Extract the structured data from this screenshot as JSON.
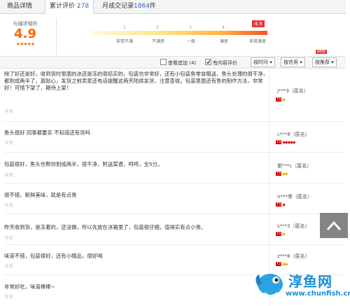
{
  "tabs": [
    {
      "label": "商品详情",
      "count": ""
    },
    {
      "label": "累计评价",
      "count": "278"
    },
    {
      "label": "月成交记录",
      "count": "1864",
      "suffix": "件"
    }
  ],
  "rating": {
    "label": "与描述相符",
    "score": "4.9",
    "stars": "★★★★★",
    "flag": "4.9",
    "ticks": [
      "1",
      "2",
      "3",
      "4",
      "5"
    ],
    "tick_labels": [
      "非常不满",
      "不满意",
      "一般",
      "满意",
      "非常满意"
    ]
  },
  "filters": {
    "follow_up": "查看追加 (4)",
    "has_content": "有内容评价",
    "sort_time": "按时间 ▾",
    "sort_credit": "按信用 ▾",
    "sort_recommend": "按推荐 ▾",
    "new_badge": "NEW"
  },
  "reviews": [
    {
      "text": "除了好还是好，收到货时里面的冰还是冻的很结实的，包装也非常好，还有小包装鱼零食赠送，鱼头处理的很干净，都割成两半了，真贴心，发货之前卖家还电话提醒这两天陆续发货，注意查收。包装里面还有鱼的制作方法，非常好！可惜下架了，期待上架！",
      "date": "今天",
      "user": "j***3（匿名）",
      "level": "T3"
    },
    {
      "text": "鱼头很好 同事都要买 不知道还有货吗",
      "date": "今天",
      "user": "c***8（匿名）",
      "level": "T3"
    },
    {
      "text": "包装很好，鱼头也帮你割成两半，很干净，附送菜谱，呵呵，全5分。",
      "date": "今天",
      "user": "紫***c（匿名）",
      "level": "T3"
    },
    {
      "text": "很不错，新鲜美味，就是有点贵",
      "date": "今天",
      "user": "n***零（匿名）",
      "level": "T3"
    },
    {
      "text": "昨天收到货，是冻着的，还没做，所以先放在冰箱里了，包装很仔细，值得实有点小贵。",
      "date": "今天",
      "user": "s***3（匿名）",
      "level": "T3"
    },
    {
      "text": "味道不错，包装很好，还有小赠品，很好喝",
      "date": "今天",
      "user": "z***8（匿名）",
      "level": "T3"
    },
    {
      "text": "非常好吃，味道棒棒~",
      "date": "今天",
      "user": "",
      "level": ""
    }
  ],
  "watermark": {
    "name": "淳鱼网",
    "url": "www.chunfish.cn"
  }
}
